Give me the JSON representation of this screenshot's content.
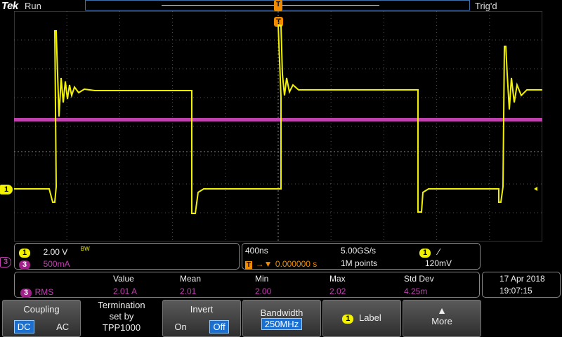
{
  "header": {
    "brand": "Tek",
    "run_state": "Run",
    "trigger_state": "Trig'd"
  },
  "markers": {
    "trigger_top": "T",
    "ch1": "1",
    "math3": "3"
  },
  "channel_box": {
    "ch1_label": "1",
    "ch1_scale": "2.00 V",
    "ch1_bw": "BW",
    "math_label": "3",
    "math_scale": "500mA"
  },
  "timebase_box": {
    "time_scale": "400ns",
    "sample_rate": "5.00GS/s",
    "position_prefix": "T",
    "position": "0.000000 s",
    "record_length": "1M points",
    "trig_ch": "1",
    "trig_level": "120mV"
  },
  "measurements": {
    "headers": [
      "Value",
      "Mean",
      "Min",
      "Max",
      "Std Dev"
    ],
    "row": {
      "source": "3",
      "name": "RMS",
      "value": "2.01 A",
      "mean": "2.01",
      "min": "2.00",
      "max": "2.02",
      "std_dev": "4.25m"
    }
  },
  "datetime": {
    "date": "17 Apr 2018",
    "time": "19:07:15"
  },
  "menu": {
    "coupling": {
      "title": "Coupling",
      "opt1": "DC",
      "opt2": "AC",
      "selected": "DC"
    },
    "termination": {
      "line1": "Termination",
      "line2": "set by",
      "line3": "TPP1000"
    },
    "invert": {
      "title": "Invert",
      "opt1": "On",
      "opt2": "Off",
      "selected": "Off"
    },
    "bandwidth": {
      "title": "Bandwidth",
      "value": "250MHz"
    },
    "label": {
      "ch": "1",
      "text": "Label"
    },
    "more": {
      "text": "More"
    }
  },
  "colors": {
    "ch1": "#f2f200",
    "math": "#c040b0",
    "grid": "#666666",
    "accent": "#1a6fd0"
  }
}
